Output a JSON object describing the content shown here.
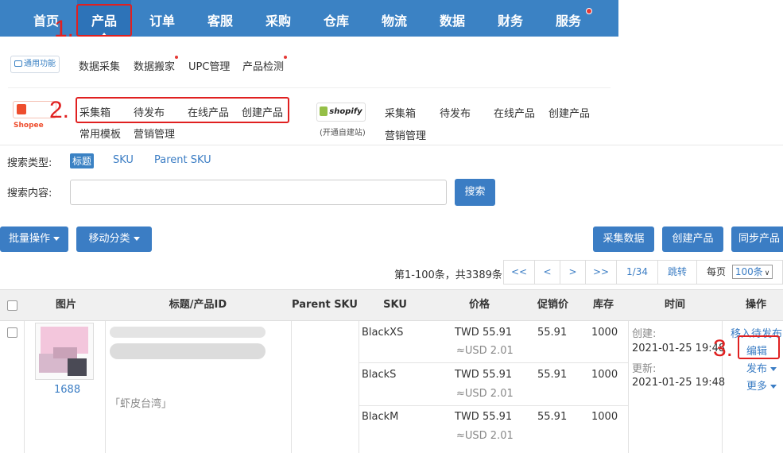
{
  "nav": {
    "items": [
      "首页",
      "产品",
      "订单",
      "客服",
      "采购",
      "仓库",
      "物流",
      "数据",
      "财务",
      "服务"
    ],
    "active": "产品"
  },
  "annotations": {
    "step1": "1.",
    "step2": "2.",
    "step3": "3."
  },
  "submenu": {
    "general_logo": "通用功能",
    "general_links": [
      "数据采集",
      "数据搬家",
      "UPC管理",
      "产品检测"
    ],
    "shopee_logo": "Shopee",
    "shopee_links": [
      "采集箱",
      "待发布",
      "在线产品",
      "创建产品"
    ],
    "shopee_links2": [
      "常用模板",
      "营销管理"
    ],
    "shopify_logo": "shopify",
    "shopify_note": "(开通自建站)",
    "shopify_links": [
      "采集箱",
      "待发布",
      "在线产品",
      "创建产品"
    ],
    "shopify_links2": [
      "营销管理"
    ]
  },
  "search": {
    "type_label": "搜索类型:",
    "types": [
      "标题",
      "SKU",
      "Parent SKU"
    ],
    "content_label": "搜索内容:",
    "content_value": "",
    "button": "搜索"
  },
  "toolbar": {
    "batch": "批量操作",
    "move": "移动分类",
    "collect": "采集数据",
    "create": "创建产品",
    "sync": "同步产品"
  },
  "pager": {
    "summary": "第1-100条，共3389条",
    "first": "<<",
    "prev": "<",
    "next": ">",
    "last": ">>",
    "page": "1/34",
    "jump": "跳转",
    "per_page_label": "每页",
    "per_page": "100条"
  },
  "table": {
    "headers": [
      "图片",
      "标题/产品ID",
      "Parent SKU",
      "SKU",
      "价格",
      "促销价",
      "库存",
      "时间",
      "操作"
    ],
    "row": {
      "image_caption": "1688",
      "tag": "「虾皮台湾」",
      "created_label": "创建:",
      "created": "2021-01-25 19:48",
      "updated_label": "更新:",
      "updated": "2021-01-25 19:48",
      "actions": {
        "move": "移入待发布",
        "edit": "编辑",
        "publish": "发布",
        "more": "更多"
      },
      "variants": [
        {
          "sku": "BlackXS",
          "price": "TWD  55.91",
          "usd": "≈USD 2.01",
          "promo": "55.91",
          "stock": "1000"
        },
        {
          "sku": "BlackS",
          "price": "TWD  55.91",
          "usd": "≈USD 2.01",
          "promo": "55.91",
          "stock": "1000"
        },
        {
          "sku": "BlackM",
          "price": "TWD  55.91",
          "usd": "≈USD 2.01",
          "promo": "55.91",
          "stock": "1000"
        }
      ]
    }
  },
  "colors": {
    "primary": "#3b82c4",
    "annotation": "#e02020"
  }
}
